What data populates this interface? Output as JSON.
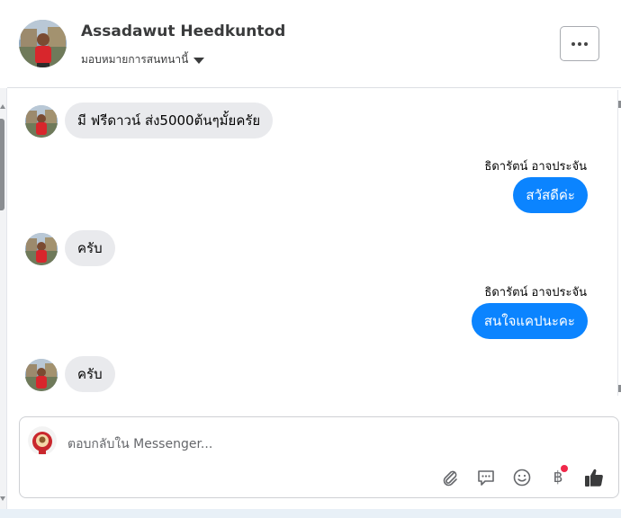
{
  "header": {
    "name": "Assadawut Heedkuntod",
    "subtitle": "มอบหมายการสนทนานี้"
  },
  "messages": [
    {
      "direction": "in",
      "text": "มี ฟรีดาวน์ ส่ง5000ต้นๆมั้ยครัย"
    },
    {
      "direction": "out",
      "sender": "ธิดารัตน์ อาจประจัน",
      "text": "สวัสดีค่ะ"
    },
    {
      "direction": "in",
      "text": "ครับ"
    },
    {
      "direction": "out",
      "sender": "ธิดารัตน์ อาจประจัน",
      "text": "สนใจแคปนะคะ"
    },
    {
      "direction": "in",
      "text": "ครับ"
    }
  ],
  "composer": {
    "placeholder": "ตอบกลับใน Messenger...",
    "tools": [
      "paperclip-icon",
      "saved-reply-icon",
      "emoji-icon",
      "baht-icon",
      "thumbs-up-icon"
    ],
    "baht_symbol": "฿"
  },
  "colors": {
    "outgoing_bubble": "#0b84ff",
    "incoming_bubble": "#e9eaed",
    "like_icon": "#3a3b3c",
    "notification_dot": "#f0284a"
  }
}
